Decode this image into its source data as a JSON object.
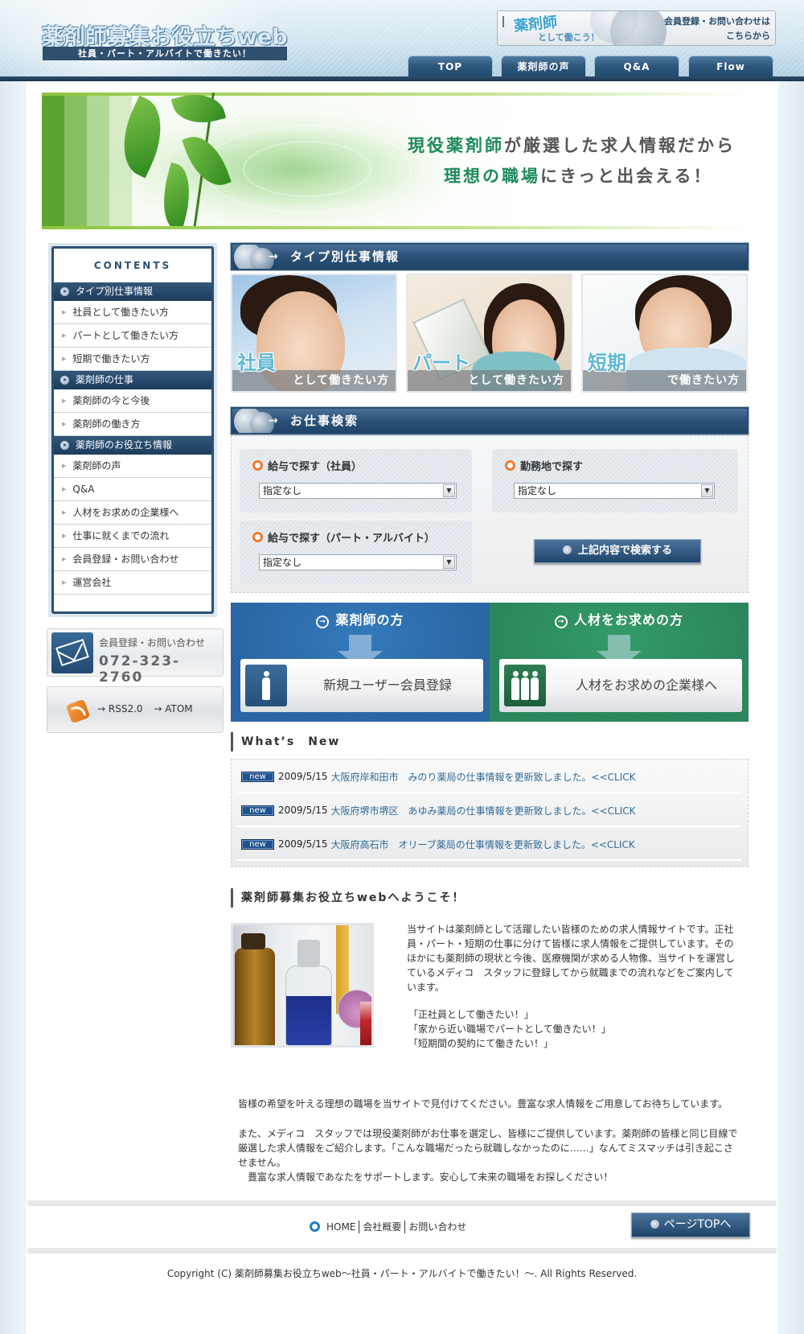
{
  "header": {
    "logo_title": "薬剤師募集お役立ちweb",
    "logo_subtitle": "社員・パート・アルバイトで働きたい！",
    "promo": {
      "big": "薬剤師",
      "small": "として働こう！",
      "line1": "会員登録・お問い合わせは",
      "line2": "こちらから"
    },
    "nav": [
      {
        "label": "TOP"
      },
      {
        "label": "薬剤師の声"
      },
      {
        "label": "Q&A"
      },
      {
        "label": "Flow"
      }
    ]
  },
  "hero": {
    "line1_highlight": "現役薬剤師",
    "line1_rest": "が厳選した求人情報だから",
    "line2_highlight": "理想の職場",
    "line2_rest": "にきっと出会える！"
  },
  "sidebar": {
    "title": "CONTENTS",
    "groups": [
      {
        "heading": "タイプ別仕事情報",
        "items": [
          "社員として働きたい方",
          "パートとして働きたい方",
          "短期で働きたい方"
        ]
      },
      {
        "heading": "薬剤師の仕事",
        "items": [
          "薬剤師の今と今後",
          "薬剤師の働き方"
        ]
      },
      {
        "heading": "薬剤師のお役立ち情報",
        "items": [
          "薬剤師の声",
          "Q&A",
          "人材をお求めの企業様へ",
          "仕事に就くまでの流れ",
          "会員登録・お問い合わせ",
          "運営会社"
        ]
      }
    ],
    "contact": {
      "label": "会員登録・お問い合わせ",
      "phone": "072-323-2760"
    },
    "feeds": {
      "rss": "→ RSS2.0",
      "atom": "→ ATOM"
    }
  },
  "type_section": {
    "heading": "タイプ別仕事情報",
    "cards": [
      {
        "big": "社員",
        "small": "として働きたい方"
      },
      {
        "big": "パート",
        "small": "として働きたい方"
      },
      {
        "big": "短期",
        "small": "で働きたい方"
      }
    ]
  },
  "search_section": {
    "heading": "お仕事検索",
    "salary_fulltime": {
      "label": "給与で探す（社員）",
      "value": "指定なし"
    },
    "location": {
      "label": "勤務地で探す",
      "value": "指定なし"
    },
    "salary_parttime": {
      "label": "給与で探す（パート・アルバイト）",
      "value": "指定なし"
    },
    "submit_label": "上記内容で検索する"
  },
  "cta": {
    "pharmacist": {
      "title": "薬剤師の方",
      "button": "新規ユーザー会員登録"
    },
    "employer": {
      "title": "人材をお求めの方",
      "button": "人材をお求めの企業様へ"
    }
  },
  "news": {
    "heading": "What’s　New",
    "badge": "new",
    "items": [
      {
        "date": "2009/5/15",
        "text": "大阪府岸和田市　みのり薬局の仕事情報を更新致しました。<<CLICK"
      },
      {
        "date": "2009/5/15",
        "text": "大阪府堺市堺区　あゆみ薬局の仕事情報を更新致しました。<<CLICK"
      },
      {
        "date": "2009/5/15",
        "text": "大阪府高石市　オリーブ薬局の仕事情報を更新致しました。<<CLICK"
      }
    ]
  },
  "welcome": {
    "heading": "薬剤師募集お役立ちwebへようこそ！",
    "intro": "当サイトは薬剤師として活躍したい皆様のための求人情報サイトです。正社員・パート・短期の仕事に分けて皆様に求人情報をご提供しています。そのほかにも薬剤師の現状と今後、医療機関が求める人物像、当サイトを運営しているメディコ　スタッフに登録してから就職までの流れなどをご案内しています。",
    "quotes": [
      "「正社員として働きたい！」",
      "「家から近い職場でパートとして働きたい！」",
      "「短期間の契約にて働きたい！」"
    ],
    "para1": "皆様の希望を叶える理想の職場を当サイトで見付けてください。豊富な求人情報をご用意してお待ちしています。",
    "para2": "また、メディコ　スタッフでは現役薬剤師がお仕事を選定し、皆様にご提供しています。薬剤師の皆様と同じ目線で厳選した求人情報をご紹介します。「こんな職場だったら就職しなかったのに……」なんてミスマッチは引き起こさせません。",
    "para3": "　豊富な求人情報であなたをサポートします。安心して未来の職場をお探しください！"
  },
  "footer": {
    "links": [
      "HOME",
      "会社概要",
      "お問い合わせ"
    ],
    "page_top": "ページTOPへ",
    "copyright": "Copyright (C) 薬剤師募集お役立ちweb～社員・パート・アルバイトで働きたい！～. All Rights Reserved."
  },
  "colors": {
    "navy": "#2c4f72",
    "accent_orange": "#ee7a2e",
    "link_blue": "#2f6a98",
    "cta_blue": "#2b66a3",
    "cta_green": "#2a8258",
    "hero_green": "#1f8a5a"
  }
}
